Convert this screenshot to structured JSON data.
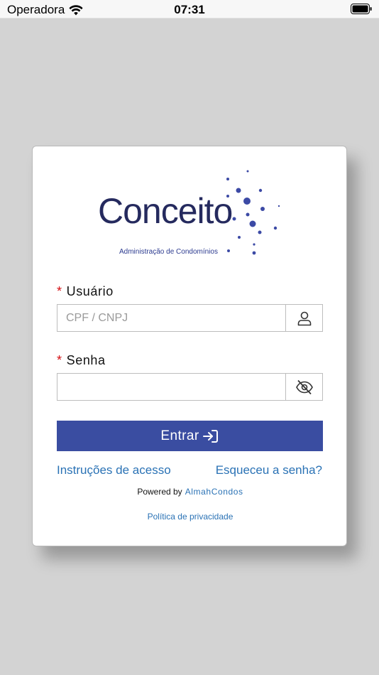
{
  "status_bar": {
    "carrier": "Operadora",
    "time": "07:31"
  },
  "logo": {
    "name": "Conceito",
    "subtitle": "Administração de Condomínios"
  },
  "form": {
    "username": {
      "label": "Usuário",
      "required_mark": "*",
      "placeholder": "CPF / CNPJ",
      "value": ""
    },
    "password": {
      "label": "Senha",
      "required_mark": "*",
      "placeholder": "",
      "value": ""
    },
    "submit_label": "Entrar"
  },
  "links": {
    "access_instructions": "Instruções de acesso",
    "forgot_password": "Esqueceu a senha?",
    "privacy_policy": "Política de privacidade"
  },
  "footer": {
    "powered_by": "Powered by",
    "brand": "AlmahCondos"
  },
  "colors": {
    "primary": "#3a4da1",
    "link": "#2a72b5",
    "required": "#d40d12",
    "logo_text": "#252a5e",
    "background": "#d3d3d3"
  }
}
